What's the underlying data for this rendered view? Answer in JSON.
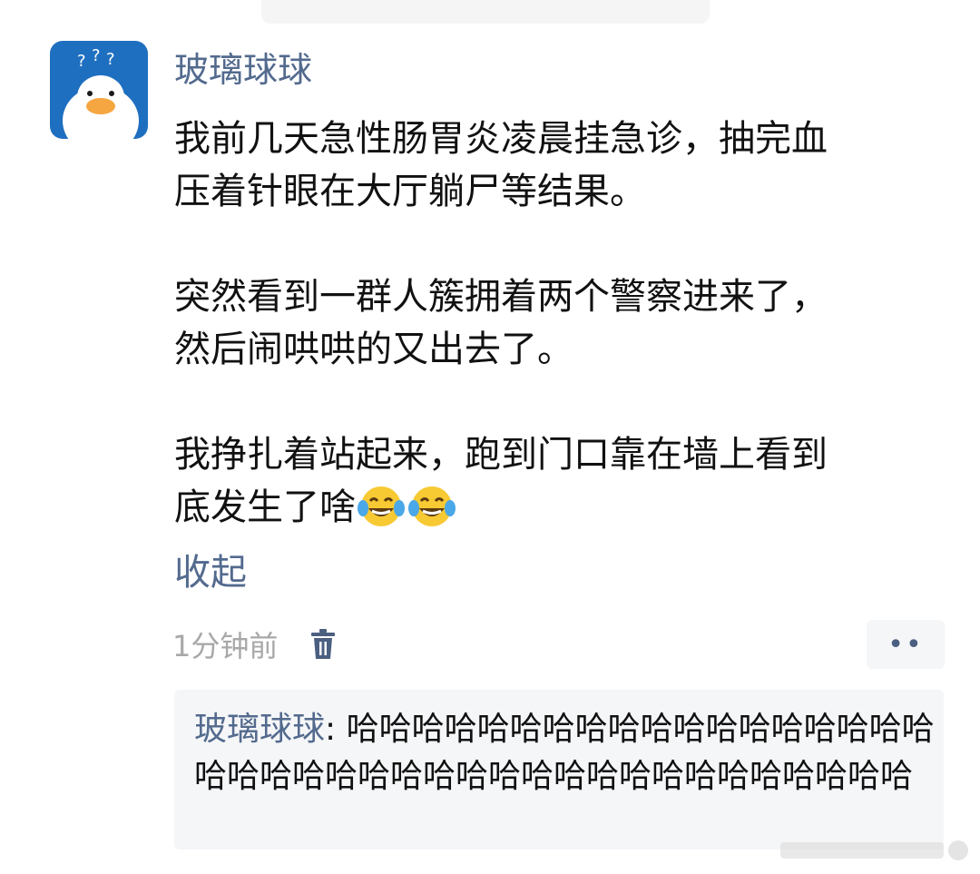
{
  "top_bar": {},
  "post": {
    "username": "玻璃球球",
    "paragraphs": [
      [
        "我前几天急性肠胃炎凌晨挂急诊，抽完血",
        "压着针眼在大厅躺尸等结果。"
      ],
      [
        "突然看到一群人簇拥着两个警察进来了，",
        "然后闹哄哄的又出去了。"
      ],
      [
        "我挣扎着站起来，跑到门口靠在墙上看到",
        "底发生了啥"
      ]
    ],
    "emojis": [
      "laugh-crying-icon",
      "laugh-crying-icon"
    ],
    "collapse_label": "收起",
    "time": "1分钟前",
    "more_label": "••"
  },
  "reply": {
    "author": "玻璃球球",
    "separator": ": ",
    "text": "哈哈哈哈哈哈哈哈哈哈哈哈哈哈哈哈哈哈哈哈哈哈哈哈哈哈哈哈哈哈哈哈哈哈哈哈哈哈哈哈"
  },
  "colors": {
    "link": "#536a8e",
    "avatar_bg": "#1f6fc0",
    "muted": "#a8a8a8",
    "reply_bg": "#f5f6f8"
  }
}
